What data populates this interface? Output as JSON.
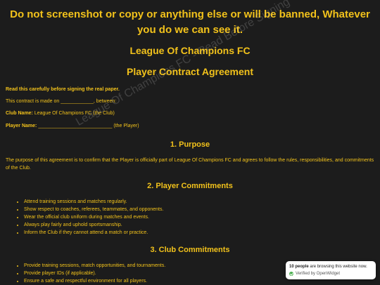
{
  "warning": "Do not screenshot or copy or anything else or will be banned, Whatever you do we can see it.",
  "title": "League Of Champions FC",
  "subtitle": "Player Contract Agreement",
  "intro": {
    "read_notice": "Read this carefully before signing the real paper.",
    "made_on": "This contract is made on ____________, between:",
    "club_name_label": "Club Name:",
    "club_name_value": "League Of Champions FC (the Club)",
    "player_name_label": "Player Name:",
    "player_name_value": "___________________________ (the Player)"
  },
  "sections": [
    {
      "heading": "1. Purpose",
      "text": "The purpose of this agreement is to confirm that the Player is officially part of League Of Champions FC and agrees to follow the rules, responsibilities, and commitments of the Club."
    },
    {
      "heading": "2. Player Commitments",
      "items": [
        "Attend training sessions and matches regularly.",
        "Show respect to coaches, referees, teammates, and opponents.",
        "Wear the official club uniform during matches and events.",
        "Always play fairly and uphold sportsmanship.",
        "Inform the Club if they cannot attend a match or practice."
      ]
    },
    {
      "heading": "3. Club Commitments",
      "items": [
        "Provide training sessions, match opportunities, and tournaments.",
        "Provide player IDs (if applicable).",
        "Ensure a safe and respectful environment for all players."
      ]
    }
  ],
  "watermark": "League Of Champions FC - Read Before Signing",
  "widget": {
    "count": "10 people",
    "count_suffix": "are browsing this website now.",
    "verified": "Verified by OpenWidget"
  },
  "colors": {
    "background": "#1c1c1c",
    "text": "#f2c21b",
    "widget_bg": "#ffffff",
    "verified_check": "#4caf50"
  }
}
